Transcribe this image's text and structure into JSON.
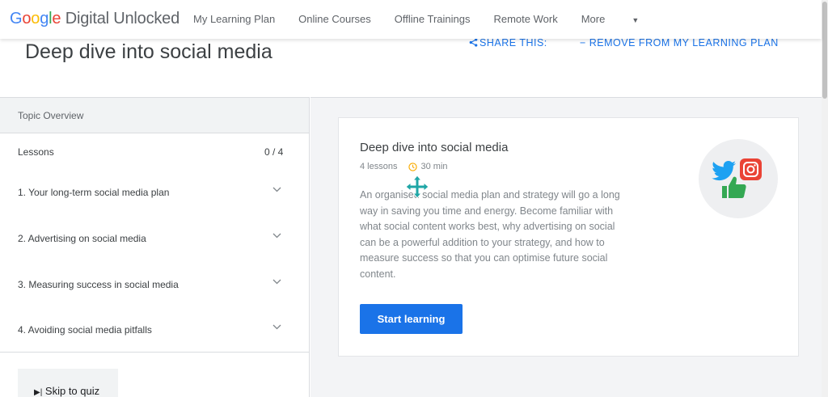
{
  "header": {
    "logo_google": [
      "G",
      "o",
      "o",
      "g",
      "l",
      "e"
    ],
    "logo_rest": " Digital Unlocked",
    "nav": [
      "My Learning Plan",
      "Online Courses",
      "Offline Trainings",
      "Remote Work",
      "More"
    ]
  },
  "page": {
    "title": "Deep dive into social media",
    "share_label": "SHARE THIS:",
    "remove_label": "REMOVE FROM MY LEARNING PLAN"
  },
  "sidebar": {
    "topic_overview": "Topic Overview",
    "lessons_label": "Lessons",
    "lessons_count": "0 / 4",
    "lessons": [
      "1. Your long-term social media plan",
      "2. Advertising on social media",
      "3. Measuring success in social media",
      "4. Avoiding social media pitfalls"
    ],
    "skip_quiz": "Skip to quiz"
  },
  "card": {
    "title": "Deep dive into social media",
    "lessons": "4 lessons",
    "duration": "30 min",
    "description": "An organised social media plan and strategy will go a long way in saving you time and energy. Become familiar with what social content works best, why advertising on social can be a powerful addition to your strategy, and how to measure success so that you can optimise future social content.",
    "start_button": "Start learning"
  },
  "colors": {
    "accent": "#1a73e8",
    "twitter": "#1DA1F2",
    "instagram": "#EA4335",
    "like": "#34A853",
    "clock": "#f9ab00"
  }
}
